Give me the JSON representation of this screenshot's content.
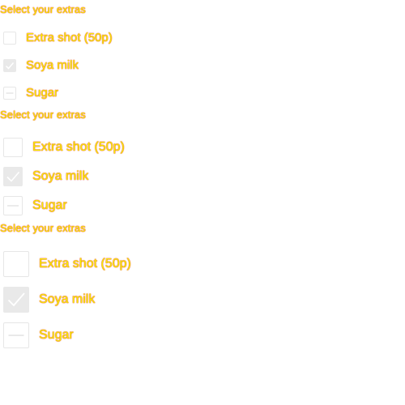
{
  "groups": [
    {
      "title": "Select your extras",
      "options": [
        {
          "label": "Extra shot (50p)",
          "state": "unchecked"
        },
        {
          "label": "Soya milk",
          "state": "checked"
        },
        {
          "label": "Sugar",
          "state": "indeterminate"
        }
      ]
    },
    {
      "title": "Select your extras",
      "options": [
        {
          "label": "Extra shot (50p)",
          "state": "unchecked"
        },
        {
          "label": "Soya milk",
          "state": "checked"
        },
        {
          "label": "Sugar",
          "state": "indeterminate"
        }
      ]
    },
    {
      "title": "Select your extras",
      "options": [
        {
          "label": "Extra shot (50p)",
          "state": "unchecked"
        },
        {
          "label": "Soya milk",
          "state": "checked"
        },
        {
          "label": "Sugar",
          "state": "indeterminate"
        }
      ]
    }
  ],
  "colors": {
    "text": "#f6ef00",
    "text_outline": "#e02400",
    "box_border": "#e6e6e6",
    "box_checked_fill": "#e9e9e9",
    "mark": "#ffffff"
  }
}
